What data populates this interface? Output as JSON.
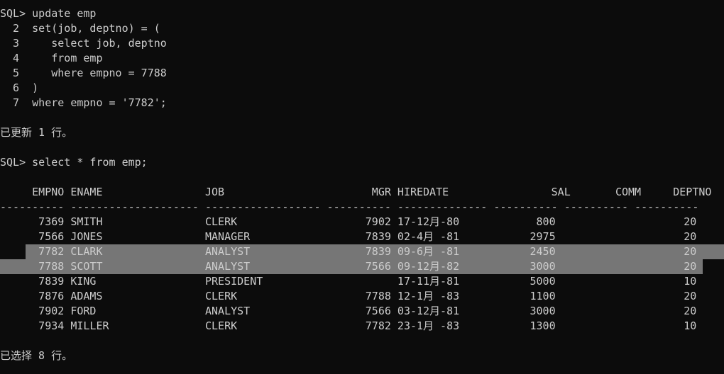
{
  "session": {
    "update_prompt": "SQL> update emp",
    "update_lines": [
      "  2  set(job, deptno) = (",
      "  3     select job, deptno",
      "  4     from emp",
      "  5     where empno = 7788",
      "  6  )",
      "  7  where empno = '7782';"
    ],
    "update_result": "已更新 1 行。",
    "select_prompt": "SQL> select * from emp;",
    "table": {
      "header": "     EMPNO ENAME                JOB                       MGR HIREDATE                SAL       COMM     DEPTNO",
      "separator": "---------- -------------------- ------------------ ---------- -------------- ---------- ---------- ----------",
      "rows": [
        "      7369 SMITH                CLERK                    7902 17-12月-80            800                    20",
        "      7566 JONES                MANAGER                  7839 02-4月 -81           2975                    20",
        "      7782 CLARK                ANALYST                  7839 09-6月 -81           2450                    20",
        "      7788 SCOTT                ANALYST                  7566 09-12月-82           3000                    20",
        "      7839 KING                 PRESIDENT                     17-11月-81           5000                    10",
        "      7876 ADAMS                CLERK                    7788 12-1月 -83           1100                    20",
        "      7902 FORD                 ANALYST                  7566 03-12月-81           3000                    20",
        "      7934 MILLER               CLERK                    7782 23-1月 -83           1300                    10"
      ]
    },
    "select_result": "已选择 8 行。"
  },
  "colors": {
    "background": "#0c0c0c",
    "text": "#cccccc",
    "selection": "#767676"
  }
}
